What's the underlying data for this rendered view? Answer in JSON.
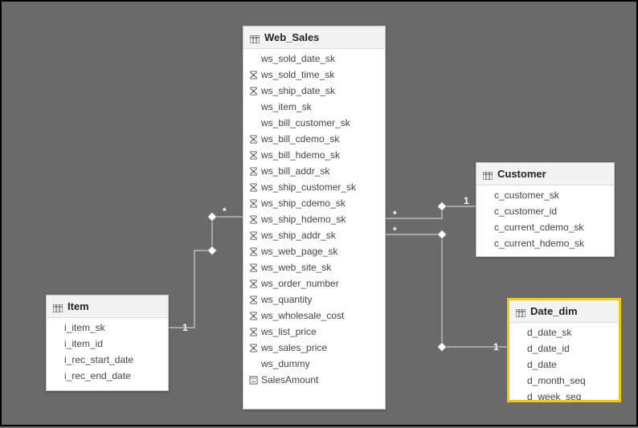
{
  "tables": {
    "item": {
      "title": "Item",
      "fields": [
        {
          "label": "i_item_sk",
          "icon": "none"
        },
        {
          "label": "i_item_id",
          "icon": "none"
        },
        {
          "label": "i_rec_start_date",
          "icon": "none"
        },
        {
          "label": "i_rec_end_date",
          "icon": "none"
        }
      ]
    },
    "web_sales": {
      "title": "Web_Sales",
      "fields": [
        {
          "label": "ws_sold_date_sk",
          "icon": "none"
        },
        {
          "label": "ws_sold_time_sk",
          "icon": "sigma"
        },
        {
          "label": "ws_ship_date_sk",
          "icon": "sigma"
        },
        {
          "label": "ws_item_sk",
          "icon": "none"
        },
        {
          "label": "ws_bill_customer_sk",
          "icon": "none"
        },
        {
          "label": "ws_bill_cdemo_sk",
          "icon": "sigma"
        },
        {
          "label": "ws_bill_hdemo_sk",
          "icon": "sigma"
        },
        {
          "label": "ws_bill_addr_sk",
          "icon": "sigma"
        },
        {
          "label": "ws_ship_customer_sk",
          "icon": "sigma"
        },
        {
          "label": "ws_ship_cdemo_sk",
          "icon": "sigma"
        },
        {
          "label": "ws_ship_hdemo_sk",
          "icon": "sigma"
        },
        {
          "label": "ws_ship_addr_sk",
          "icon": "sigma"
        },
        {
          "label": "ws_web_page_sk",
          "icon": "sigma"
        },
        {
          "label": "ws_web_site_sk",
          "icon": "sigma"
        },
        {
          "label": "ws_order_number",
          "icon": "sigma"
        },
        {
          "label": "ws_quantity",
          "icon": "sigma"
        },
        {
          "label": "ws_wholesale_cost",
          "icon": "sigma"
        },
        {
          "label": "ws_list_price",
          "icon": "sigma"
        },
        {
          "label": "ws_sales_price",
          "icon": "sigma"
        },
        {
          "label": "ws_dummy",
          "icon": "none"
        },
        {
          "label": "SalesAmount",
          "icon": "calc"
        }
      ]
    },
    "customer": {
      "title": "Customer",
      "fields": [
        {
          "label": "c_customer_sk",
          "icon": "none"
        },
        {
          "label": "c_customer_id",
          "icon": "none"
        },
        {
          "label": "c_current_cdemo_sk",
          "icon": "none"
        },
        {
          "label": "c_current_hdemo_sk",
          "icon": "none"
        }
      ]
    },
    "date_dim": {
      "title": "Date_dim",
      "fields": [
        {
          "label": "d_date_sk",
          "icon": "none"
        },
        {
          "label": "d_date_id",
          "icon": "none"
        },
        {
          "label": "d_date",
          "icon": "none"
        },
        {
          "label": "d_month_seq",
          "icon": "none"
        },
        {
          "label": "d_week_seq",
          "icon": "none"
        }
      ]
    }
  },
  "relationships": [
    {
      "from_card": "1",
      "to_card": "*"
    },
    {
      "from_card": "1",
      "to_card": "*"
    },
    {
      "from_card": "1",
      "to_card": "*"
    }
  ],
  "cardinality_labels": {
    "item_one": "1",
    "item_many": "*",
    "customer_one": "1",
    "customer_many": "*",
    "date_one": "1",
    "date_many": "*"
  }
}
